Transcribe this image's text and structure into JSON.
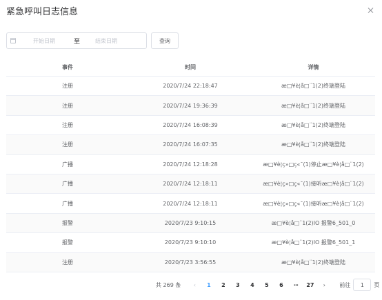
{
  "dialog": {
    "title": "紧急呼叫日志信息",
    "close_icon": "close-icon"
  },
  "filter": {
    "start_placeholder": "开始日期",
    "separator": "至",
    "end_placeholder": "结束日期",
    "query_label": "查询",
    "calendar_icon": "calendar-icon"
  },
  "table": {
    "headers": [
      "事件",
      "时间",
      "详情"
    ],
    "rows": [
      [
        "注册",
        "2020/7/24 22:18:47",
        "æ□¥è¦å□¨1(2)终端登陆"
      ],
      [
        "注册",
        "2020/7/24 19:36:39",
        "æ□¥è¦å□¨1(2)终端登陆"
      ],
      [
        "注册",
        "2020/7/24 16:08:39",
        "æ□¥è¦å□¨1(2)终端登陆"
      ],
      [
        "注册",
        "2020/7/24 16:07:35",
        "æ□¥è¦å□¨1(2)终端登陆"
      ],
      [
        "广播",
        "2020/7/24 12:18:28",
        "æ□¥è¦ç»□ç«¯(1)停止æ□¥è¦å□¨1(2)"
      ],
      [
        "广播",
        "2020/7/24 12:18:11",
        "æ□¥è¦ç»□ç«¯(1)接听æ□¥è¦å□¨1(2)"
      ],
      [
        "广播",
        "2020/7/24 12:18:11",
        "æ□¥è¦ç»□ç«¯(1)接听æ□¥è¦å□¨1(2)"
      ],
      [
        "报警",
        "2020/7/23 9:10:15",
        "æ□¥è¦å□¨1(2)IO 报警6_501_0"
      ],
      [
        "报警",
        "2020/7/23 9:10:10",
        "æ□¥è¦å□¨1(2)IO 报警6_501_1"
      ],
      [
        "注册",
        "2020/7/23 3:56:55",
        "æ□¥è¦å□¨1(2)终端登陆"
      ]
    ]
  },
  "pagination": {
    "total": "共 269 条",
    "prev": "‹",
    "pages": [
      "1",
      "2",
      "3",
      "4",
      "5",
      "6"
    ],
    "more": "···",
    "last": "27",
    "next": "›",
    "goto_label": "前往",
    "goto_value": "1",
    "page_unit": "页",
    "current_page": "1"
  }
}
